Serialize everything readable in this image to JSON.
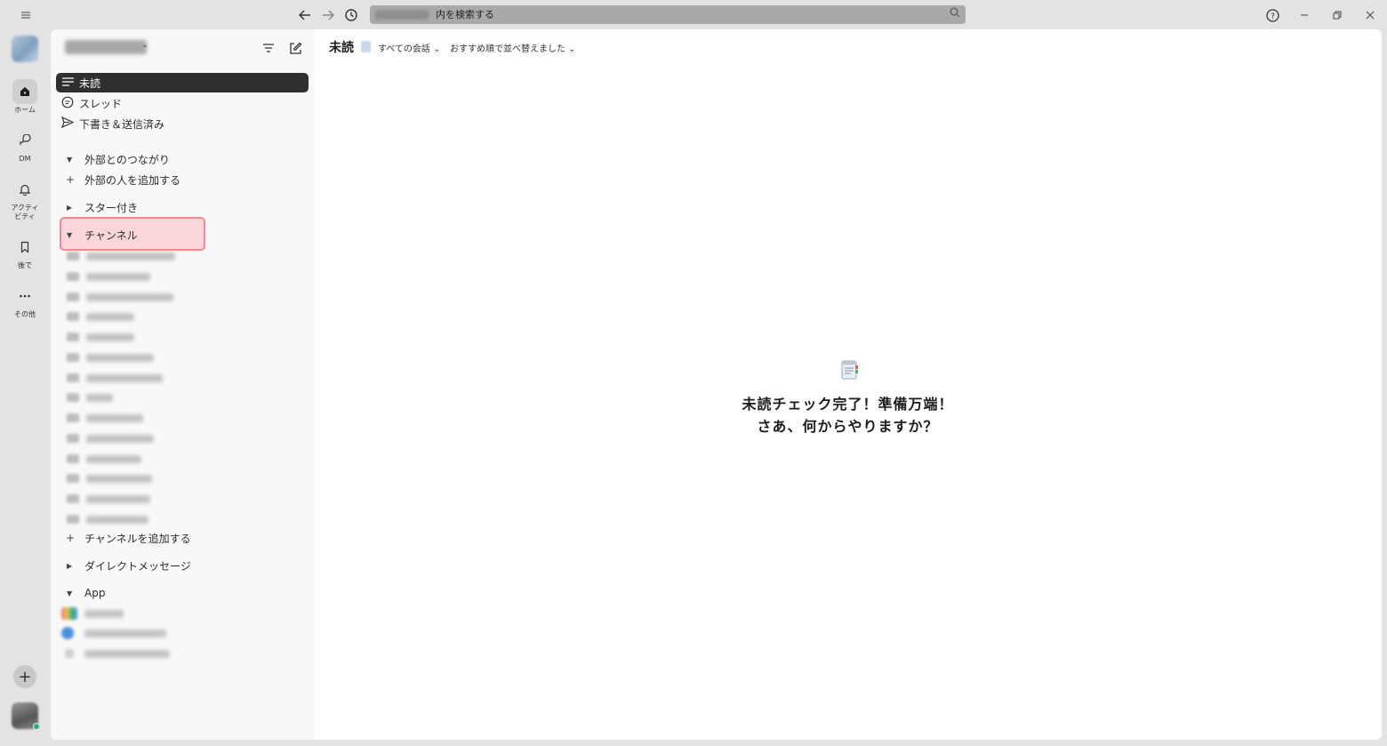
{
  "titlebar": {
    "menu_icon": "hamburger-icon",
    "back_icon": "arrow-left-icon",
    "forward_icon": "arrow-right-icon",
    "history_icon": "clock-icon",
    "search_text": "内を検索する",
    "search_icon": "magnifier-icon",
    "help_icon": "question-circle-icon",
    "minimize_icon": "minimize-icon",
    "restore_icon": "restore-icon",
    "close_icon": "close-icon"
  },
  "rail": {
    "items": [
      {
        "label": "ホーム",
        "icon": "home-icon"
      },
      {
        "label": "DM",
        "icon": "dm-icon"
      },
      {
        "label": "アクティ\nビティ",
        "icon": "bell-icon"
      },
      {
        "label": "後で",
        "icon": "bookmark-icon"
      },
      {
        "label": "その他",
        "icon": "more-icon"
      }
    ],
    "add_icon": "plus-icon"
  },
  "sidebar": {
    "nav": [
      {
        "label": "未読",
        "icon": "list-icon"
      },
      {
        "label": "スレッド",
        "icon": "thread-icon"
      },
      {
        "label": "下書き＆送信済み",
        "icon": "send-icon"
      }
    ],
    "sections": {
      "external": "外部とのつながり",
      "add_external": "外部の人を追加する",
      "starred": "スター付き",
      "channels": "チャンネル",
      "add_channel": "チャンネルを追加する",
      "dm": "ダイレクトメッセージ",
      "app": "App"
    }
  },
  "main": {
    "title": "未読",
    "filter_all": "すべての会話 ⌄",
    "filter_sort": "おすすめ順で並べ替えました ⌄",
    "empty_icon": "notepad-icon",
    "empty_line1": "未読チェック完了！準備万端！",
    "empty_line2": "さあ、何からやりますか？"
  }
}
